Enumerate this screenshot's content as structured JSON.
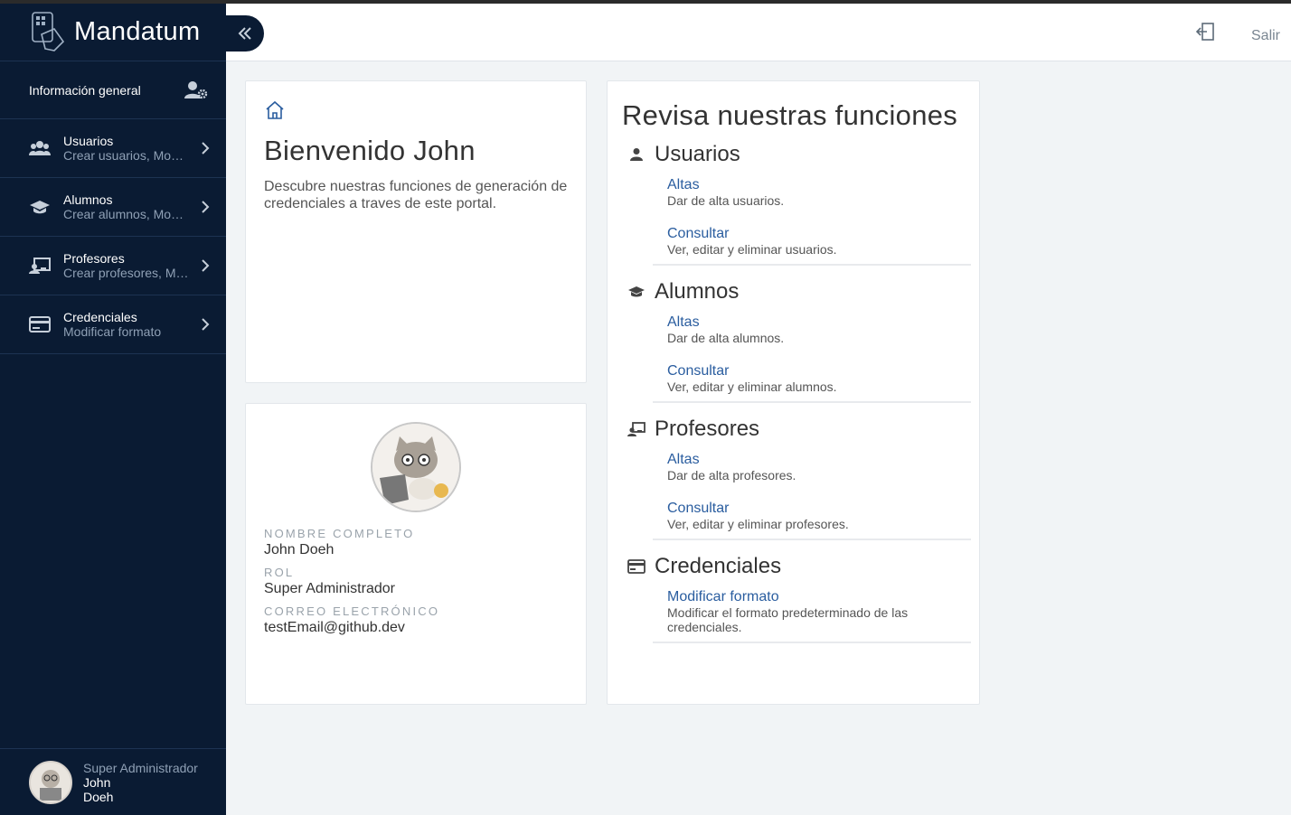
{
  "app": {
    "name": "Mandatum"
  },
  "sidebar": {
    "general": {
      "label": "Información general"
    },
    "items": [
      {
        "title": "Usuarios",
        "subtitle": "Crear usuarios, Modificar usuarios"
      },
      {
        "title": "Alumnos",
        "subtitle": "Crear alumnos, Modificar alumnos"
      },
      {
        "title": "Profesores",
        "subtitle": "Crear profesores, Modificar profesores"
      },
      {
        "title": "Credenciales",
        "subtitle": "Modificar formato"
      }
    ],
    "footer": {
      "role": "Super Administrador",
      "first_name": "John",
      "last_name": "Doeh"
    }
  },
  "header": {
    "logout_label": "Salir"
  },
  "welcome": {
    "title": "Bienvenido John",
    "text": "Descubre nuestras funciones de generación de credenciales a traves de este portal."
  },
  "profile": {
    "name_label": "Nombre completo",
    "name_value": "John Doeh",
    "role_label": "Rol",
    "role_value": "Super Administrador",
    "email_label": "Correo electrónico",
    "email_value": "testEmail@github.dev"
  },
  "features": {
    "title": "Revisa nuestras funciones",
    "sections": [
      {
        "title": "Usuarios",
        "icon": "user-icon",
        "links": [
          {
            "label": "Altas",
            "desc": "Dar de alta usuarios."
          },
          {
            "label": "Consultar",
            "desc": "Ver, editar y eliminar usuarios."
          }
        ]
      },
      {
        "title": "Alumnos",
        "icon": "graduation-cap-icon",
        "links": [
          {
            "label": "Altas",
            "desc": "Dar de alta alumnos."
          },
          {
            "label": "Consultar",
            "desc": "Ver, editar y eliminar alumnos."
          }
        ]
      },
      {
        "title": "Profesores",
        "icon": "teacher-icon",
        "links": [
          {
            "label": "Altas",
            "desc": "Dar de alta profesores."
          },
          {
            "label": "Consultar",
            "desc": "Ver, editar y eliminar profesores."
          }
        ]
      },
      {
        "title": "Credenciales",
        "icon": "credit-card-icon",
        "links": [
          {
            "label": "Modificar formato",
            "desc": "Modificar el formato predeterminado de las credenciales."
          }
        ]
      }
    ]
  },
  "colors": {
    "sidebar_bg": "#0a1b33",
    "link": "#2a5d9f",
    "page_bg": "#f1f4f6"
  }
}
